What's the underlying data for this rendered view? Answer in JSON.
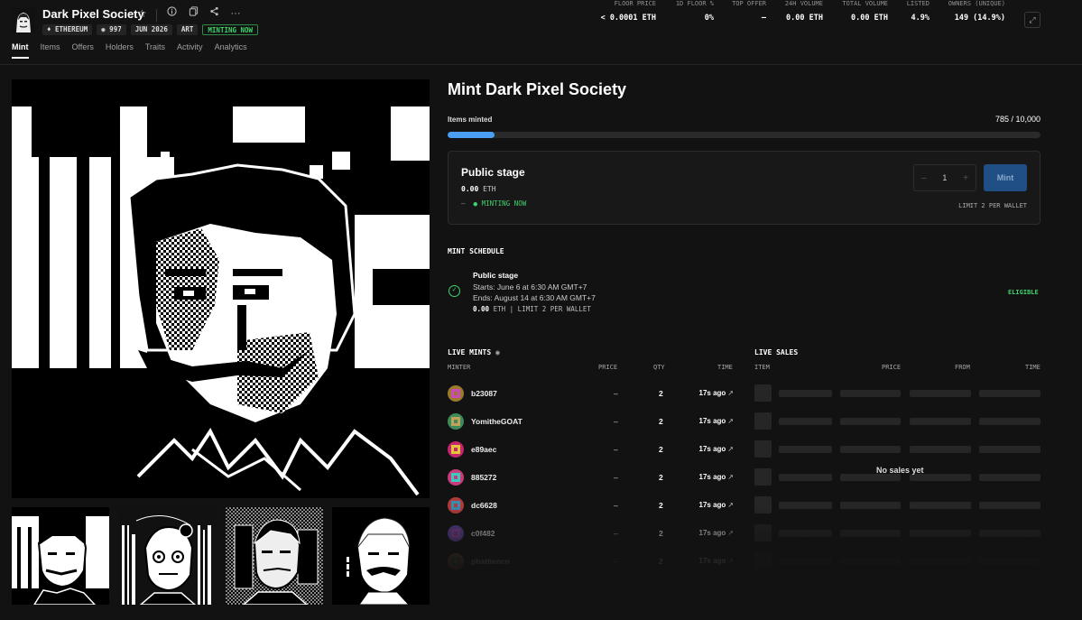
{
  "header": {
    "title": "Dark Pixel Society",
    "tags": [
      "♦ ETHEREUM",
      "◉ 997",
      "JUN 2026",
      "ART"
    ],
    "status_tag": "MINTING NOW",
    "tabs": [
      "Mint",
      "Items",
      "Offers",
      "Holders",
      "Traits",
      "Activity",
      "Analytics"
    ],
    "active_tab": "Mint"
  },
  "stats": [
    {
      "label": "FLOOR PRICE",
      "value": "< 0.0001 ETH"
    },
    {
      "label": "1D FLOOR %",
      "value": "0%"
    },
    {
      "label": "TOP OFFER",
      "value": "–"
    },
    {
      "label": "24H VOLUME",
      "value": "0.00 ETH"
    },
    {
      "label": "TOTAL VOLUME",
      "value": "0.00 ETH"
    },
    {
      "label": "LISTED",
      "value": "4.9%"
    },
    {
      "label": "OWNERS (UNIQUE)",
      "value": "149 (14.9%)"
    }
  ],
  "mint": {
    "title": "Mint Dark Pixel Society",
    "items_minted_label": "Items minted",
    "items_minted_value": "785 / 10,000",
    "progress_fraction": 0.0785,
    "stage": {
      "name": "Public stage",
      "price_num": "0.00",
      "price_unit": "ETH",
      "status_prefix": "–",
      "status": "● MINTING NOW",
      "quantity": "1",
      "minus": "–",
      "plus": "+",
      "mint_button": "Mint",
      "limit": "LIMIT 2 PER WALLET"
    }
  },
  "schedule": {
    "heading": "MINT SCHEDULE",
    "stage_name": "Public stage",
    "starts": "Starts: June 6 at 6:30 AM GMT+7",
    "ends": "Ends: August 14 at 6:30 AM GMT+7",
    "price_num": "0.00",
    "price_rest": "ETH | LIMIT 2 PER WALLET",
    "eligibility": "ELIGIBLE"
  },
  "live_mints": {
    "heading": "LIVE MINTS",
    "columns": {
      "minter": "MINTER",
      "price": "PRICE",
      "qty": "QTY",
      "time": "TIME"
    },
    "rows": [
      {
        "minter": "b23087",
        "price": "–",
        "qty": "2",
        "time": "17s ago"
      },
      {
        "minter": "YomitheGOAT",
        "price": "–",
        "qty": "2",
        "time": "17s ago"
      },
      {
        "minter": "e89aec",
        "price": "–",
        "qty": "2",
        "time": "17s ago"
      },
      {
        "minter": "885272",
        "price": "–",
        "qty": "2",
        "time": "17s ago"
      },
      {
        "minter": "dc6628",
        "price": "–",
        "qty": "2",
        "time": "17s ago"
      },
      {
        "minter": "c0f482",
        "price": "–",
        "qty": "2",
        "time": "17s ago"
      },
      {
        "minter": "phattiencn",
        "price": "–",
        "qty": "2",
        "time": "17s ago"
      }
    ]
  },
  "live_sales": {
    "heading": "LIVE SALES",
    "columns": {
      "item": "ITEM",
      "price": "PRICE",
      "from": "FROM",
      "time": "TIME"
    },
    "empty_text": "No sales yet"
  },
  "colors": {
    "accent_green": "#3ed36a",
    "progress_blue": "#4a9ff5",
    "mint_button": "#1f4f85",
    "background": "#121212"
  }
}
